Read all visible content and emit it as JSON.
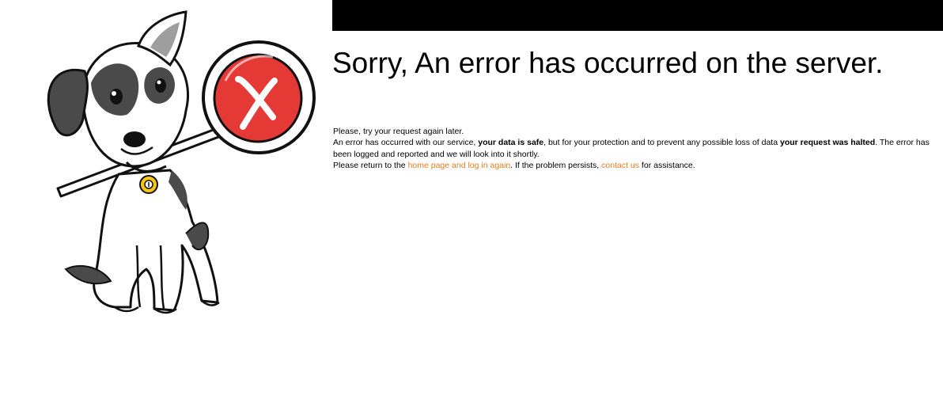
{
  "colors": {
    "top_bar": "#000000",
    "link": "#e67e22",
    "stop_sign": "#e53935",
    "dog_patch": "#4a4a4a",
    "tag": "#f5c518"
  },
  "illustration": {
    "icon": "dog-holding-stop-sign-icon"
  },
  "header": {
    "title": "Sorry, An error has occurred on the server."
  },
  "message": {
    "line1": "Please, try your request again later.",
    "line2_part1": "An error has occurred with our service, ",
    "line2_bold1": "your data is safe",
    "line2_part2": ", but for your protection and to prevent any possible loss of data ",
    "line2_bold2": "your request was halted",
    "line2_part3": ". The error has been logged and reported and we will look into it shortly.",
    "line3_part1": "Please return to the ",
    "home_link": "home page and log in again",
    "line3_part2": ". If the problem persists, ",
    "contact_link": "contact us",
    "line3_part3": " for assistance."
  }
}
